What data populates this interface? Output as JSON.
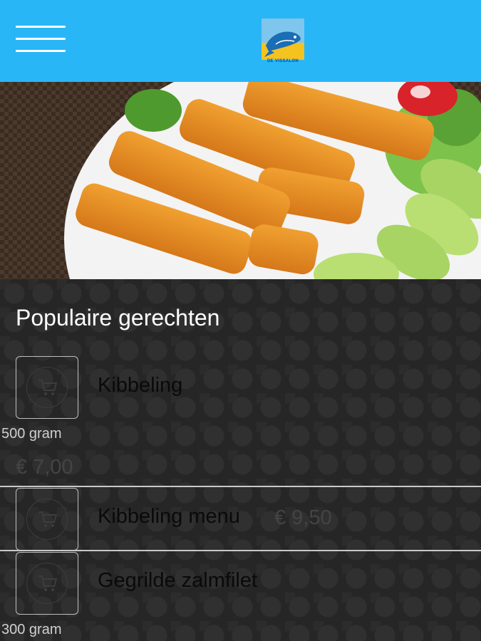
{
  "header": {
    "menu_icon": "hamburger-menu-icon",
    "logo": {
      "icon": "fish-logo",
      "text": "DE VISSALON"
    },
    "background": "#29b6f6"
  },
  "hero": {
    "image": "fish-sticks-plate-photo"
  },
  "section": {
    "title": "Populaire gerechten"
  },
  "products": [
    {
      "name": "Kibbeling",
      "weight": "500 gram",
      "price": "€ 7,00",
      "icon": "shopping-cart-icon"
    },
    {
      "name": "Kibbeling menu",
      "weight": "",
      "price": "€ 9,50",
      "icon": "shopping-cart-icon"
    },
    {
      "name": "Gegrilde zalmfilet",
      "weight": "300 gram",
      "price": "",
      "icon": "shopping-cart-icon"
    }
  ]
}
